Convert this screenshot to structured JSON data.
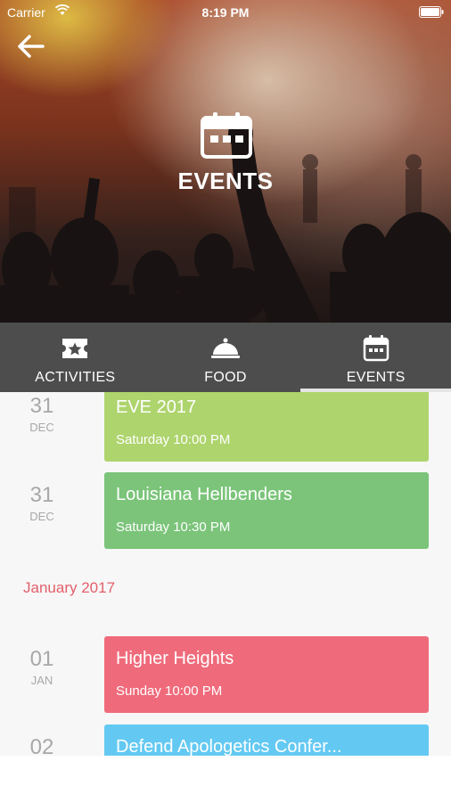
{
  "status_bar": {
    "carrier": "Carrier",
    "time": "8:19 PM"
  },
  "hero": {
    "title": "EVENTS",
    "icon": "calendar-icon"
  },
  "tabs": [
    {
      "label": "ACTIVITIES",
      "icon": "ticket-star-icon",
      "selected": false
    },
    {
      "label": "FOOD",
      "icon": "cloche-icon",
      "selected": false
    },
    {
      "label": "EVENTS",
      "icon": "calendar-icon",
      "selected": true
    }
  ],
  "events": [
    {
      "day": "31",
      "month": "DEC",
      "title": "EVE 2017",
      "time": "Saturday 10:00 PM",
      "color": "#aed46d"
    },
    {
      "day": "31",
      "month": "DEC",
      "title": "Louisiana Hellbenders",
      "time": "Saturday 10:30 PM",
      "color": "#7bc47a"
    }
  ],
  "month_header": "January 2017",
  "events_2": [
    {
      "day": "01",
      "month": "JAN",
      "title": "Higher Heights",
      "time": "Sunday 10:00 PM",
      "color": "#ef6b7b"
    },
    {
      "day": "02",
      "month": "",
      "title": "Defend Apologetics Confer...",
      "time": "",
      "color": "#63c9f2"
    }
  ],
  "colors": {
    "tab_bar": "#4d4d4d",
    "list_background": "#f7f7f7",
    "month_header": "#e35f6b",
    "date_text": "#a8a8a8"
  }
}
